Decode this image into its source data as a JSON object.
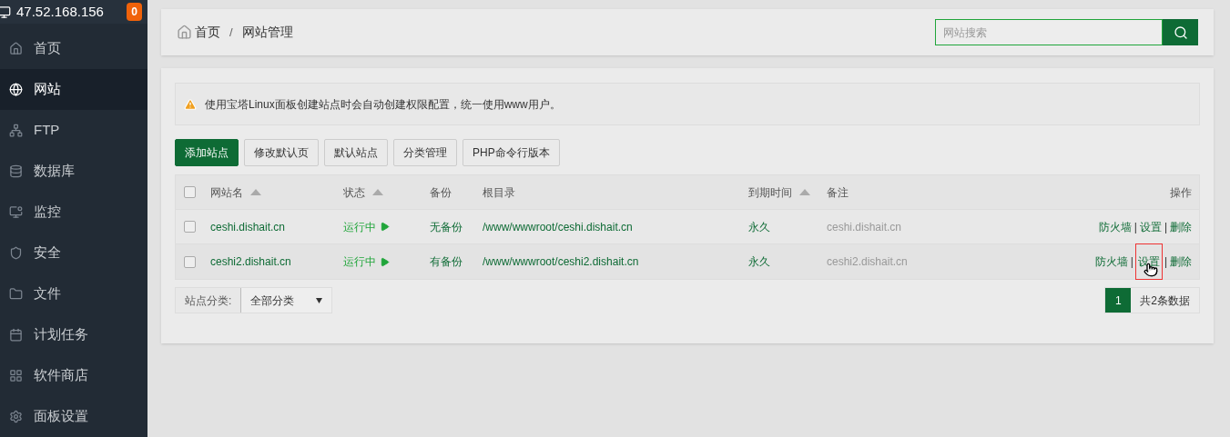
{
  "sidebar": {
    "server_ip": "47.52.168.156",
    "badge": "0",
    "items": [
      {
        "kind": "home",
        "label": "首页",
        "selected": false
      },
      {
        "kind": "globe",
        "label": "网站",
        "selected": true
      },
      {
        "kind": "ftp",
        "label": "FTP",
        "selected": false
      },
      {
        "kind": "database",
        "label": "数据库",
        "selected": false
      },
      {
        "kind": "monitor",
        "label": "监控",
        "selected": false
      },
      {
        "kind": "shield",
        "label": "安全",
        "selected": false
      },
      {
        "kind": "folder",
        "label": "文件",
        "selected": false
      },
      {
        "kind": "calendar",
        "label": "计划任务",
        "selected": false
      },
      {
        "kind": "grid",
        "label": "软件商店",
        "selected": false
      },
      {
        "kind": "gear",
        "label": "面板设置",
        "selected": false
      }
    ]
  },
  "breadcrumb": [
    {
      "kind": "link",
      "text": "首页"
    },
    {
      "kind": "separator",
      "text": "/"
    },
    {
      "kind": "current",
      "text": "网站管理"
    }
  ],
  "search": {
    "placeholder": "网站搜索"
  },
  "notice": "使用宝塔Linux面板创建站点时会自动创建权限配置，统一使用www用户。",
  "toolbar": [
    {
      "label": "添加站点",
      "primary": true
    },
    {
      "label": "修改默认页",
      "primary": false
    },
    {
      "label": "默认站点",
      "primary": false
    },
    {
      "label": "分类管理",
      "primary": false
    },
    {
      "label": "PHP命令行版本",
      "primary": false
    }
  ],
  "table": {
    "select_all_checked": false,
    "columns": [
      {
        "label": "网站名",
        "sortable": true
      },
      {
        "label": "状态",
        "sortable": true
      },
      {
        "label": "备份",
        "sortable": false
      },
      {
        "label": "根目录",
        "sortable": false
      },
      {
        "label": "到期时间",
        "sortable": true
      },
      {
        "label": "备注",
        "sortable": false
      },
      {
        "label": "操作",
        "sortable": false
      }
    ],
    "rows": [
      {
        "checked": false,
        "name": "ceshi.dishait.cn",
        "status": "运行中",
        "backup": "无备份",
        "root": "/www/wwwroot/ceshi.dishait.cn",
        "expiry": "永久",
        "remark": "ceshi.dishait.cn",
        "actions": [
          {
            "kind": "link",
            "label": "防火墙",
            "highlighted": false
          },
          {
            "kind": "separator",
            "label": "|"
          },
          {
            "kind": "link",
            "label": "设置",
            "highlighted": false
          },
          {
            "kind": "separator",
            "label": "|"
          },
          {
            "kind": "link",
            "label": "删除",
            "highlighted": false
          }
        ]
      },
      {
        "checked": false,
        "name": "ceshi2.dishait.cn",
        "status": "运行中",
        "backup": "有备份",
        "root": "/www/wwwroot/ceshi2.dishait.cn",
        "expiry": "永久",
        "remark": "ceshi2.dishait.cn",
        "actions": [
          {
            "kind": "link",
            "label": "防火墙",
            "highlighted": false
          },
          {
            "kind": "separator",
            "label": "|"
          },
          {
            "kind": "link",
            "label": "设置",
            "highlighted": true
          },
          {
            "kind": "separator",
            "label": "|"
          },
          {
            "kind": "link",
            "label": "删除",
            "highlighted": false
          }
        ]
      }
    ]
  },
  "category_filter": {
    "label": "站点分类:",
    "value": "全部分类"
  },
  "pagination": {
    "pages": [
      {
        "label": "1",
        "selected": true
      }
    ],
    "total": "共2条数据"
  }
}
